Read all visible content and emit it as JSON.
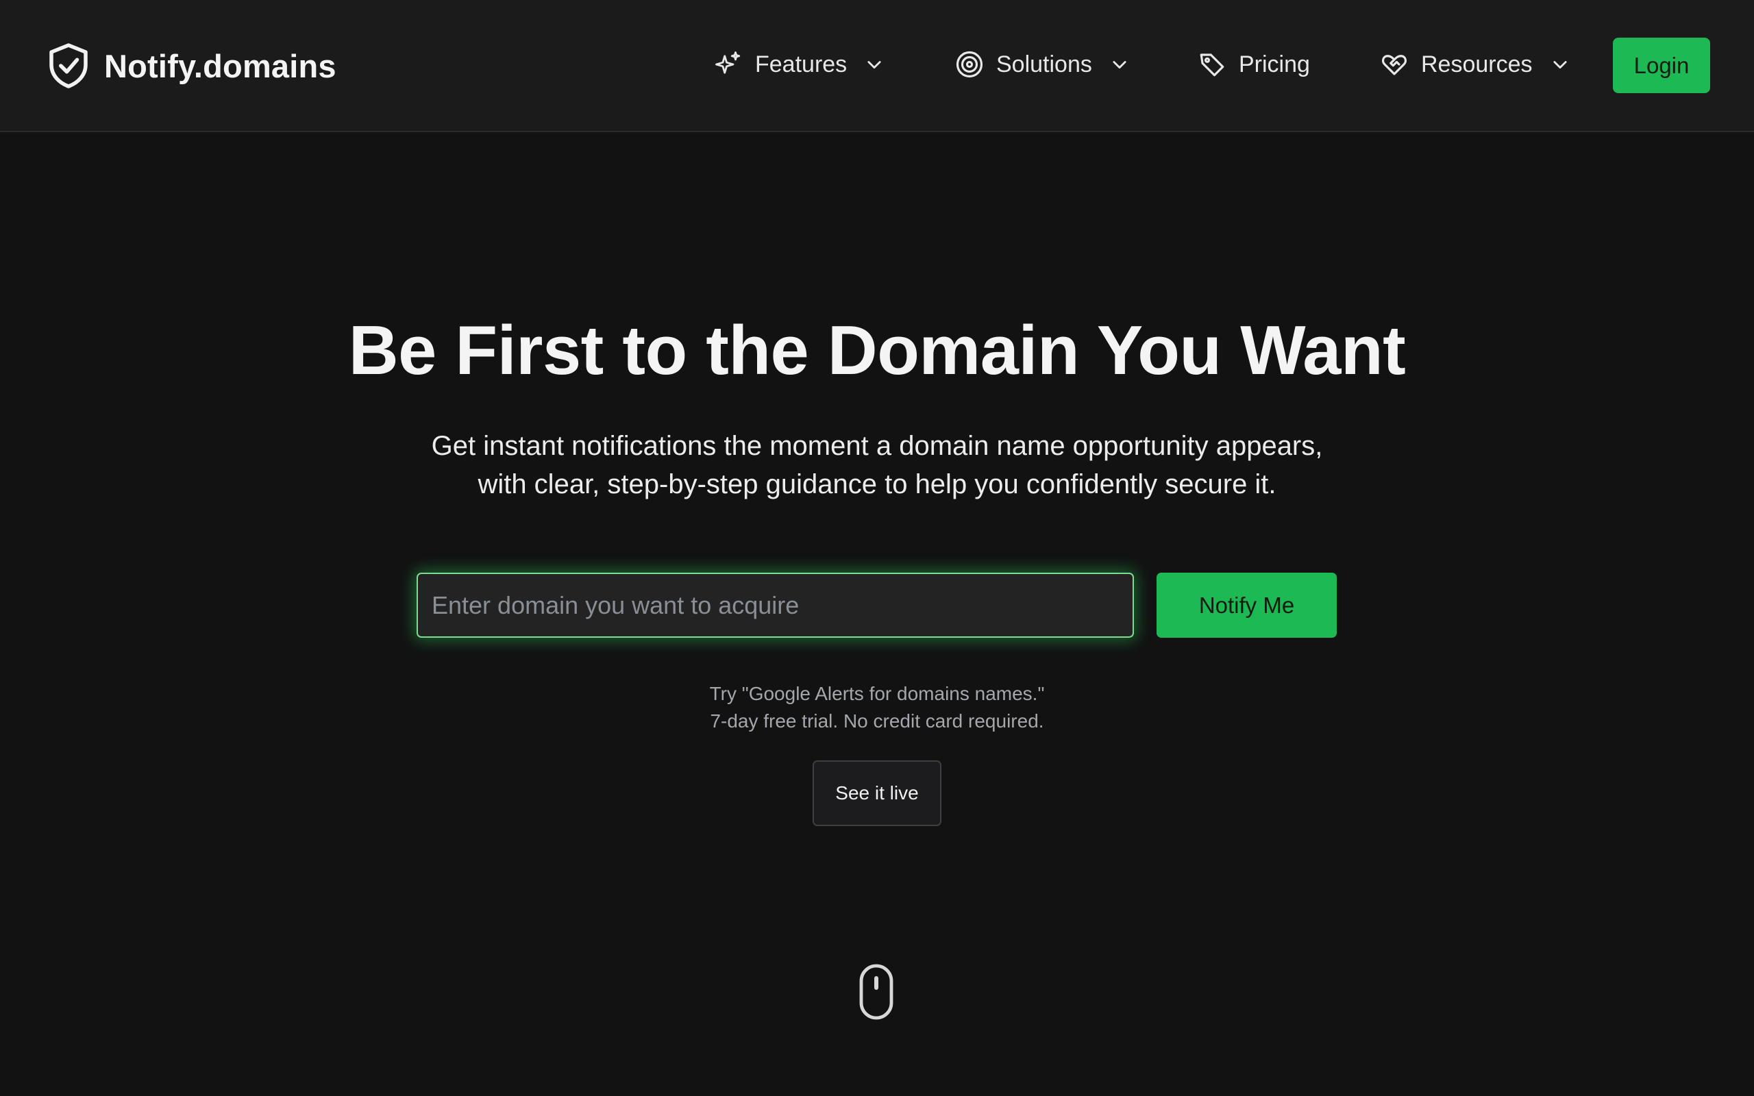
{
  "brand": {
    "name": "Notify.domains",
    "icon": "shield-check-icon"
  },
  "nav": {
    "items": [
      {
        "label": "Features",
        "icon": "sparkles-icon",
        "dropdown": true
      },
      {
        "label": "Solutions",
        "icon": "target-icon",
        "dropdown": true
      },
      {
        "label": "Pricing",
        "icon": "tag-icon",
        "dropdown": false
      },
      {
        "label": "Resources",
        "icon": "heart-handshake-icon",
        "dropdown": true
      }
    ],
    "login_label": "Login"
  },
  "hero": {
    "title": "Be First to the Domain You Want",
    "subtitle_line1": "Get instant notifications the moment a domain name opportunity appears,",
    "subtitle_line2": "with clear, step-by-step guidance to help you confidently secure it.",
    "input_placeholder": "Enter domain you want to acquire",
    "input_value": "",
    "notify_label": "Notify Me",
    "tagline_line1": "Try \"Google Alerts for domains names.\"",
    "tagline_line2": "7-day free trial. No credit card required.",
    "see_live_label": "See it live"
  },
  "colors": {
    "accent": "#1db954",
    "background": "#121212",
    "navbar": "#1b1b1b",
    "input_glow": "#7ddc8f"
  },
  "scroll_indicator": {
    "icon": "mouse-icon"
  }
}
